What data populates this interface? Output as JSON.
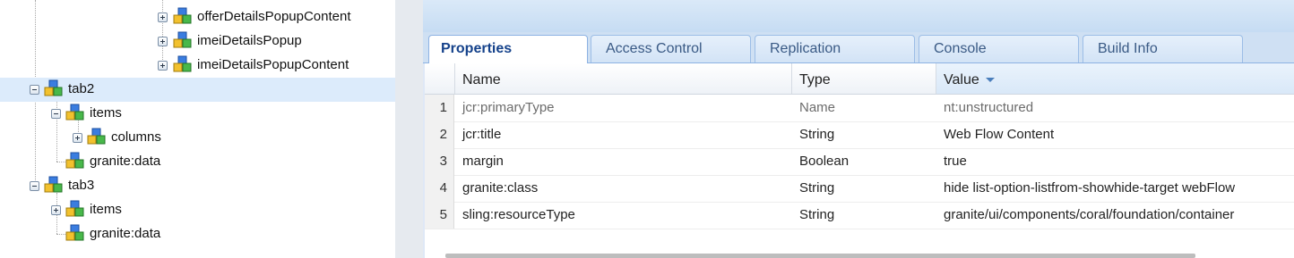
{
  "tree": {
    "nodes": [
      {
        "id": "offerDetailsPopupContent",
        "label": "offerDetailsPopupContent",
        "toggle": "plus"
      },
      {
        "id": "imeiDetailsPopup",
        "label": "imeiDetailsPopup",
        "toggle": "plus"
      },
      {
        "id": "imeiDetailsPopupContent",
        "label": "imeiDetailsPopupContent",
        "toggle": "plus"
      },
      {
        "id": "tab2",
        "label": "tab2",
        "toggle": "minus",
        "selected": true
      },
      {
        "id": "tab2-items",
        "label": "items",
        "toggle": "minus"
      },
      {
        "id": "tab2-columns",
        "label": "columns",
        "toggle": "plus"
      },
      {
        "id": "tab2-granite-data",
        "label": "granite:data",
        "toggle": "none"
      },
      {
        "id": "tab3",
        "label": "tab3",
        "toggle": "minus"
      },
      {
        "id": "tab3-items",
        "label": "items",
        "toggle": "plus"
      },
      {
        "id": "tab3-granite-data",
        "label": "granite:data",
        "toggle": "none"
      }
    ]
  },
  "tabs": [
    {
      "label": "Properties",
      "active": true
    },
    {
      "label": "Access Control"
    },
    {
      "label": "Replication"
    },
    {
      "label": "Console"
    },
    {
      "label": "Build Info"
    }
  ],
  "grid": {
    "columns": {
      "name": "Name",
      "type": "Type",
      "value": "Value"
    },
    "sorted_column": "Value",
    "rows": [
      {
        "num": "1",
        "name": "jcr:primaryType",
        "type": "Name",
        "value": "nt:unstructured",
        "dim": true
      },
      {
        "num": "2",
        "name": "jcr:title",
        "type": "String",
        "value": "Web Flow Content"
      },
      {
        "num": "3",
        "name": "margin",
        "type": "Boolean",
        "value": "true"
      },
      {
        "num": "4",
        "name": "granite:class",
        "type": "String",
        "value": "hide list-option-listfrom-showhide-target webFlow"
      },
      {
        "num": "5",
        "name": "sling:resourceType",
        "type": "String",
        "value": "granite/ui/components/coral/foundation/container"
      }
    ]
  },
  "colors": {
    "selection": "#dcebfb",
    "tab_text": "#3a5a85",
    "active_tab_text": "#15428b",
    "sort_arrow": "#4a7ebb"
  },
  "icons": {
    "node": "node-cubes-icon",
    "expand": "expand-plus-icon",
    "collapse": "collapse-minus-icon",
    "sort": "sort-descending-icon"
  }
}
